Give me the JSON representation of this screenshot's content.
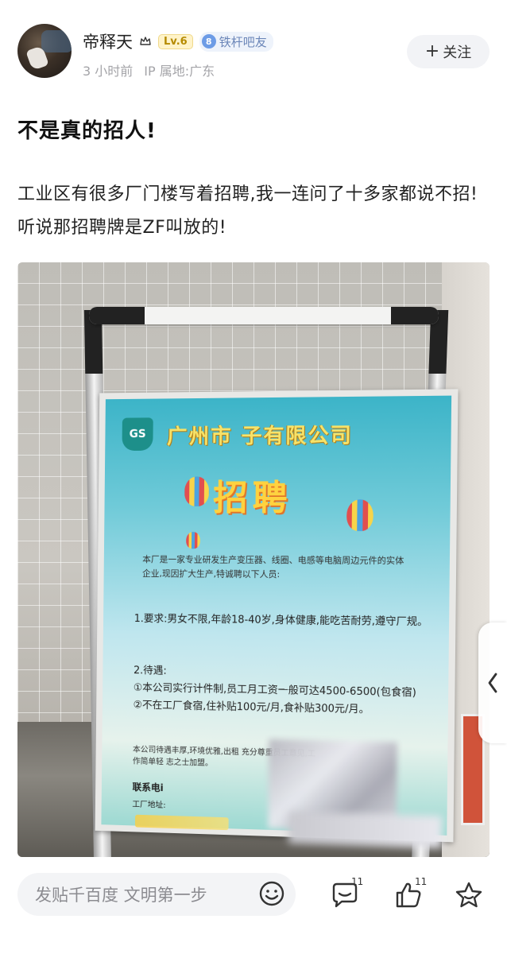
{
  "header": {
    "username": "帝释天",
    "level_badge": "Lv.6",
    "fan_badge_num": "8",
    "fan_badge_label": "铁杆吧友",
    "time_ago": "3 小时前",
    "ip_location": "IP 属地:广东",
    "follow_label": "关注",
    "follow_plus": "+"
  },
  "post": {
    "title": "不是真的招人!",
    "body": "工业区有很多厂门楼写着招聘,我一连问了十多家都说不招!听说那招聘牌是ZF叫放的!"
  },
  "photo_sign": {
    "logo_text": "GS",
    "company_name": "广州市 子有限公司",
    "headline": "招聘",
    "intro": "本厂是一家专业研发生产变压器、线圈、电感等电脑周边元件的实体企业,现因扩大生产,特诚聘以下人员:",
    "requirements": "1.要求:男女不限,年龄18-40岁,身体健康,能吃苦耐劳,遵守厂规。",
    "pay_title": "2.待遇:",
    "pay_1": "①本公司实行计件制,员工月工资一般可达4500-6500(包食宿)",
    "pay_2": "②不在工厂食宿,住补贴100元/月,食补贴300元/月。",
    "benefits_text": "本公司待遇丰厚,环境优雅,出租 充分尊重员工意见,工作简单轻 志之士加盟。",
    "contact_label": "联系电i",
    "address_label": "工厂地址:"
  },
  "bottom_bar": {
    "reply_placeholder": "发贴千百度 文明第一步",
    "comment_count": "11",
    "like_count": "11"
  },
  "icons": {
    "emoji": "emoji-icon",
    "comment": "comment-icon",
    "like": "like-icon",
    "star": "star-icon",
    "side": "chevron-left-icon"
  },
  "colors": {
    "fan_badge": "#6d9ce6",
    "level_badge": "#b58a00",
    "meta_text": "#a4a4a8",
    "follow_bg": "#f2f3f6"
  }
}
